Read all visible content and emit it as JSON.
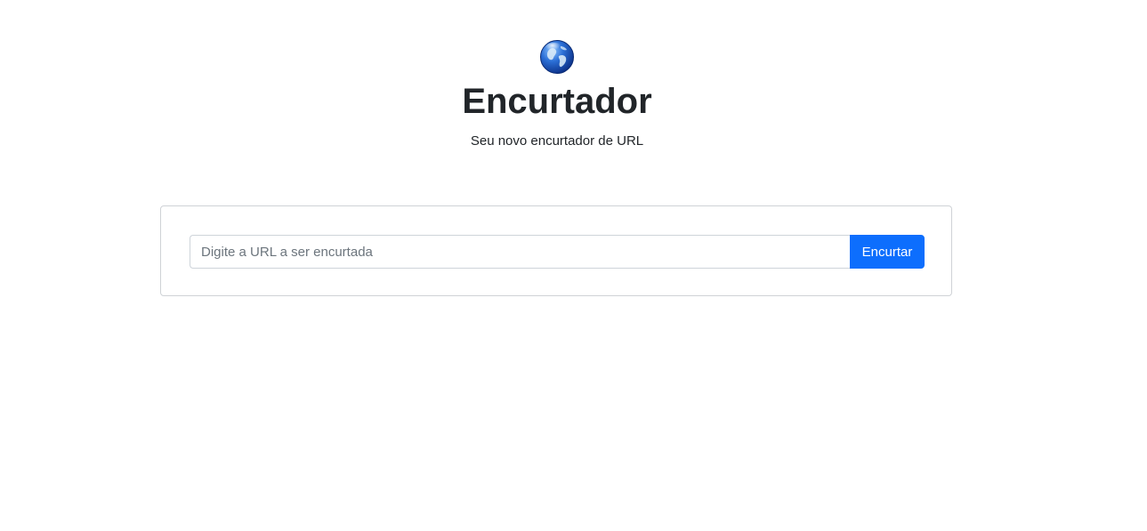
{
  "header": {
    "logo_icon": "globe-icon",
    "title": "Encurtador",
    "subtitle": "Seu novo encurtador de URL"
  },
  "form": {
    "url_input": {
      "value": "",
      "placeholder": "Digite a URL a ser encurtada"
    },
    "submit_label": "Encurtar"
  },
  "colors": {
    "primary": "#0d6efd",
    "text": "#212529",
    "placeholder": "#6c757d",
    "border": "#ced4da"
  }
}
